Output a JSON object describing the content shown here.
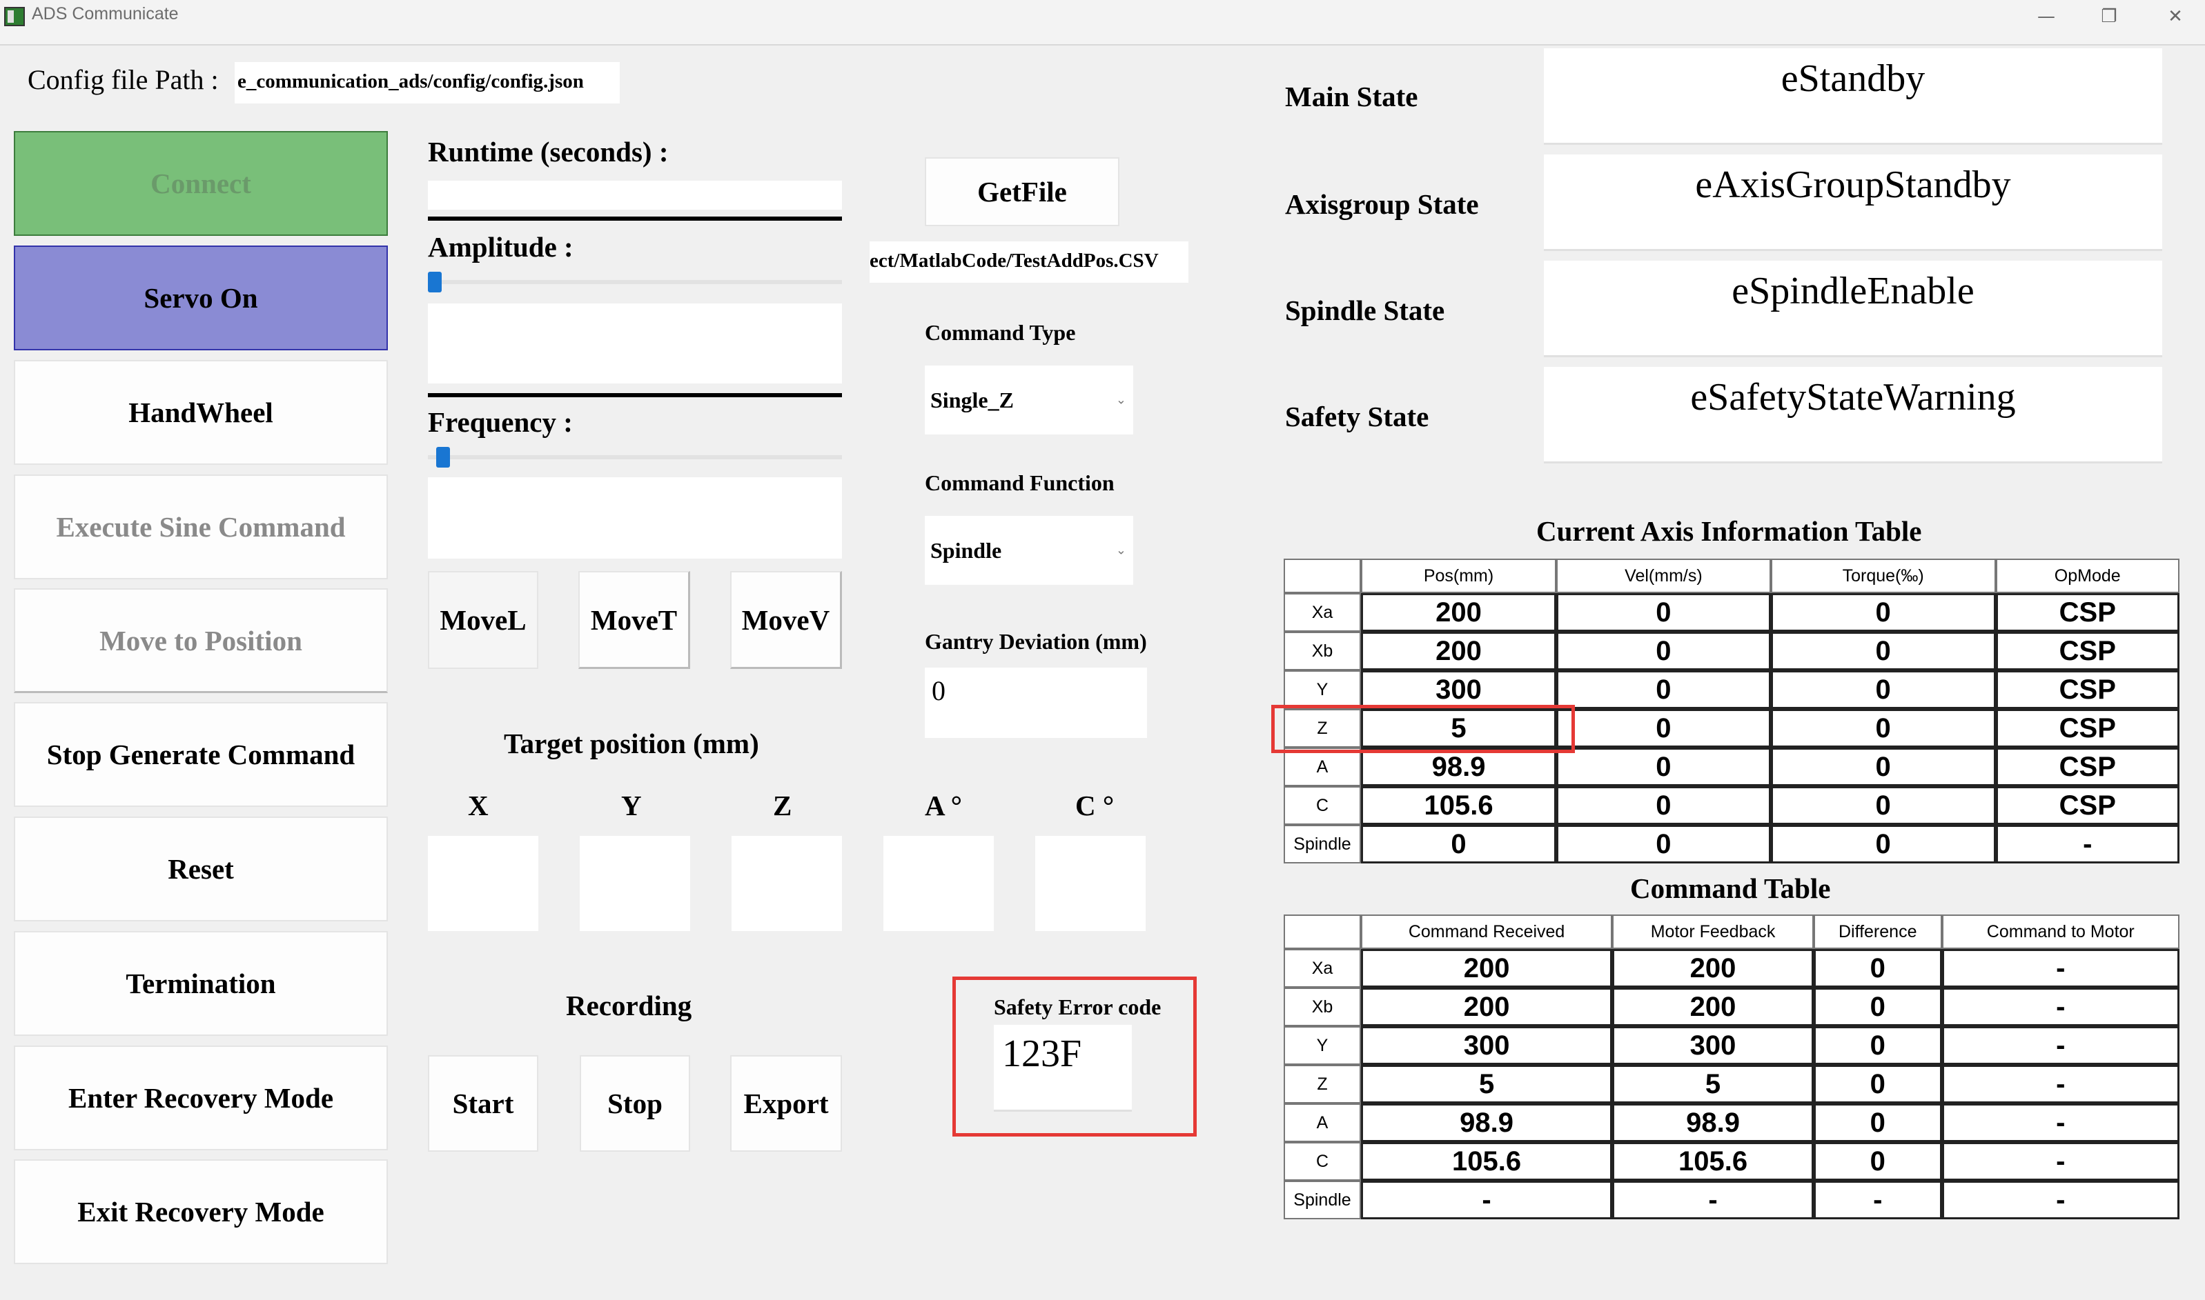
{
  "window": {
    "title": "ADS Communicate"
  },
  "config": {
    "label": "Config file Path :",
    "path": "e_communication_ads/config/config.json"
  },
  "left_buttons": {
    "connect": "Connect",
    "servo_on": "Servo On",
    "handwheel": "HandWheel",
    "execute_sine": "Execute Sine Command",
    "move_to_position": "Move to Position",
    "stop_generate": "Stop Generate Command",
    "reset": "Reset",
    "termination": "Termination",
    "enter_recovery": "Enter Recovery Mode",
    "exit_recovery": "Exit Recovery Mode"
  },
  "params": {
    "runtime_label": "Runtime (seconds) :",
    "amplitude_label": "Amplitude :",
    "frequency_label": "Frequency :",
    "amplitude_slider": 0,
    "frequency_slider": 0.02
  },
  "motion": {
    "movel": "MoveL",
    "movet": "MoveT",
    "movev": "MoveV"
  },
  "target": {
    "title": "Target position (mm)",
    "axes": [
      "X",
      "Y",
      "Z",
      "A °",
      "C °"
    ]
  },
  "recording": {
    "title": "Recording",
    "start": "Start",
    "stop": "Stop",
    "export": "Export"
  },
  "file": {
    "getfile": "GetFile",
    "path": "ect/MatlabCode/TestAddPos.CSV"
  },
  "command": {
    "type_label": "Command Type",
    "type_value": "Single_Z",
    "function_label": "Command Function",
    "function_value": "Spindle",
    "gantry_label": "Gantry Deviation (mm)",
    "gantry_value": "0"
  },
  "safety": {
    "label": "Safety Error code",
    "code": "123F"
  },
  "states": [
    {
      "label": "Main State",
      "value": "eStandby"
    },
    {
      "label": "Axisgroup State",
      "value": "eAxisGroupStandby"
    },
    {
      "label": "Spindle State",
      "value": "eSpindleEnable"
    },
    {
      "label": "Safety State",
      "value": "eSafetyStateWarning"
    }
  ],
  "axis_table": {
    "title": "Current Axis Information Table",
    "columns": [
      "Pos(mm)",
      "Vel(mm/s)",
      "Torque(‰)",
      "OpMode"
    ],
    "rows": [
      {
        "name": "Xa",
        "cells": [
          "200",
          "0",
          "0",
          "CSP"
        ]
      },
      {
        "name": "Xb",
        "cells": [
          "200",
          "0",
          "0",
          "CSP"
        ]
      },
      {
        "name": "Y",
        "cells": [
          "300",
          "0",
          "0",
          "CSP"
        ]
      },
      {
        "name": "Z",
        "cells": [
          "5",
          "0",
          "0",
          "CSP"
        ]
      },
      {
        "name": "A",
        "cells": [
          "98.9",
          "0",
          "0",
          "CSP"
        ]
      },
      {
        "name": "C",
        "cells": [
          "105.6",
          "0",
          "0",
          "CSP"
        ]
      },
      {
        "name": "Spindle",
        "cells": [
          "0",
          "0",
          "0",
          "-"
        ]
      }
    ]
  },
  "command_table": {
    "title": "Command Table",
    "columns": [
      "Command Received",
      "Motor Feedback",
      "Difference",
      "Command to Motor"
    ],
    "rows": [
      {
        "name": "Xa",
        "cells": [
          "200",
          "200",
          "0",
          "-"
        ]
      },
      {
        "name": "Xb",
        "cells": [
          "200",
          "200",
          "0",
          "-"
        ]
      },
      {
        "name": "Y",
        "cells": [
          "300",
          "300",
          "0",
          "-"
        ]
      },
      {
        "name": "Z",
        "cells": [
          "5",
          "5",
          "0",
          "-"
        ]
      },
      {
        "name": "A",
        "cells": [
          "98.9",
          "98.9",
          "0",
          "-"
        ]
      },
      {
        "name": "C",
        "cells": [
          "105.6",
          "105.6",
          "0",
          "-"
        ]
      },
      {
        "name": "Spindle",
        "cells": [
          "-",
          "-",
          "-",
          "-"
        ]
      }
    ]
  },
  "colors": {
    "connect_bg": "#79bf79",
    "servo_bg": "#8a8bd4",
    "highlight": "#e53935",
    "slider": "#1976d2"
  }
}
